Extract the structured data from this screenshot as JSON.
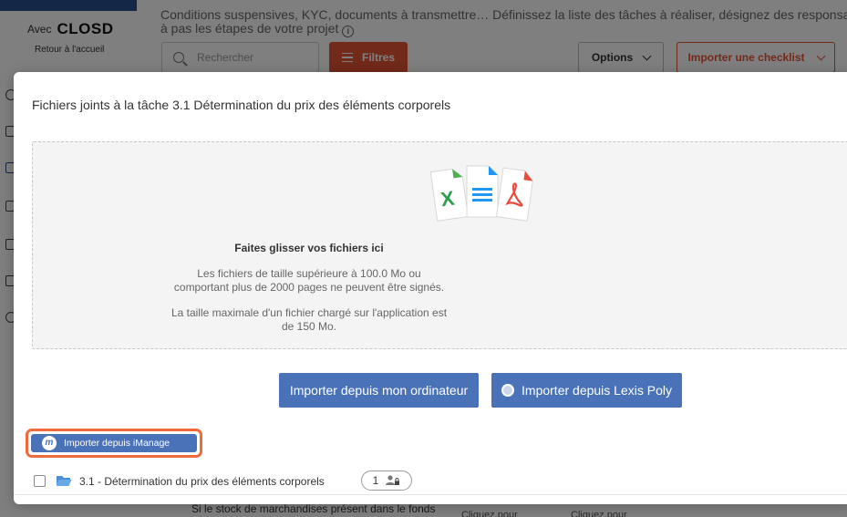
{
  "background": {
    "brand": {
      "prefix": "Avec",
      "logo": "CLOSD",
      "home_link": "Retour à l'accueil"
    },
    "intro_line1": "Conditions suspensives, KYC, documents à transmettre… Définissez la liste des tâches à réaliser, désignez des responsables",
    "intro_line2": "à pas les étapes de votre projet",
    "toolbar": {
      "search_placeholder": "Rechercher",
      "filters_label": "Filtres",
      "options_label": "Options",
      "import_checklist_label": "Importer une checklist"
    },
    "table_row_text": "Si le stock de marchandises présent dans le fonds",
    "click_text_1": "Cliquez pour",
    "click_text_2": "Cliquez pour"
  },
  "modal": {
    "title": "Fichiers joints à la tâche 3.1 Détermination du prix des éléments corporels",
    "dropzone": {
      "title": "Faites glisser vos fichiers ici",
      "text_line1": "Les fichiers de taille supérieure à 100.0 Mo ou",
      "text_line2": "comportant plus de 2000 pages ne peuvent être signés.",
      "text_line3": "La taille maximale d'un fichier chargé sur l'application est",
      "text_line4": "de 150 Mo.",
      "icons": [
        "excel-file-icon",
        "document-file-icon",
        "pdf-file-icon"
      ]
    },
    "buttons": {
      "import_computer": "Importer depuis mon ordinateur",
      "import_lexis": "Importer depuis Lexis Poly",
      "import_imanage": "Importer depuis iManage"
    },
    "folder_row": {
      "label": "3.1 - Détermination du prix des éléments corporels",
      "count": "1"
    }
  },
  "colors": {
    "accent_red": "#e55535",
    "button_blue": "#4a72b8",
    "highlight_orange": "#ef6b3b"
  }
}
